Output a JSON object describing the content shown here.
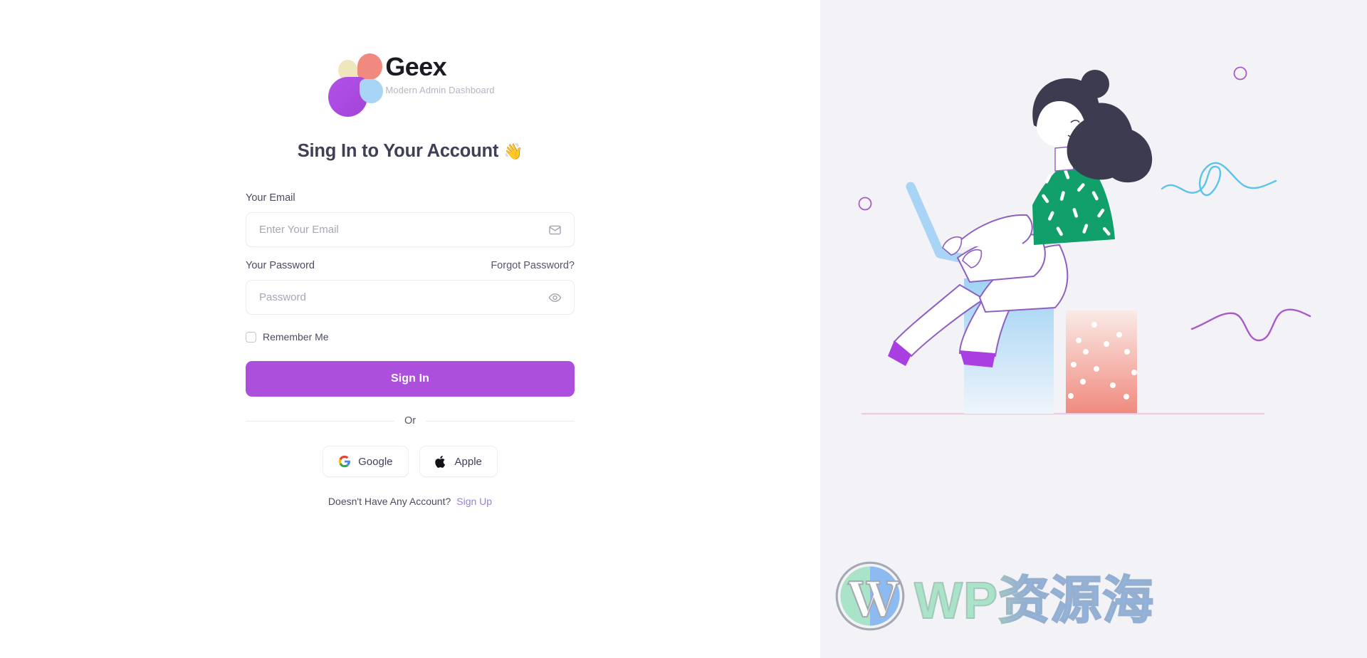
{
  "brand": {
    "name": "Geex",
    "tagline": "Modern Admin Dashboard",
    "logo_colors": {
      "cream": "#f0e6bb",
      "coral": "#f08a7e",
      "purple": "#ad4fdd",
      "blue": "#a8d4f5"
    }
  },
  "auth": {
    "heading": "Sing In to Your Account",
    "heading_emoji": "👋",
    "email": {
      "label": "Your Email",
      "placeholder": "Enter Your Email",
      "value": "",
      "icon": "envelope-icon"
    },
    "password": {
      "label": "Your Password",
      "placeholder": "Password",
      "value": "",
      "icon": "eye-icon",
      "forgot_label": "Forgot Password?"
    },
    "remember": {
      "label": "Remember Me",
      "checked": false
    },
    "submit_label": "Sign In",
    "divider_label": "Or",
    "social": [
      {
        "label": "Google",
        "icon": "google-icon"
      },
      {
        "label": "Apple",
        "icon": "apple-icon"
      }
    ],
    "footer": {
      "question": "Doesn't Have Any Account?",
      "link_label": "Sign Up"
    },
    "accent_color": "#ad4fdd",
    "link_color": "#9b7fd4"
  },
  "illustration": {
    "alt": "woman-with-laptop-illustration",
    "background_color": "#f3f2f7",
    "shirt_color": "#12a06a",
    "hair_color": "#3d3b4f",
    "laptop_color": "#a8d4f5",
    "block_blue": "#a8d8f5",
    "block_pink": "#f09a8e",
    "shoe_color": "#a93fe0",
    "outline_color": "#8e5fc0",
    "squiggle_blue": "#5bc4ea",
    "squiggle_purple": "#a85bc8",
    "ground_line": "#f0c8e4"
  },
  "watermark": {
    "text": "WP资源海",
    "logo": "wordpress-icon"
  }
}
